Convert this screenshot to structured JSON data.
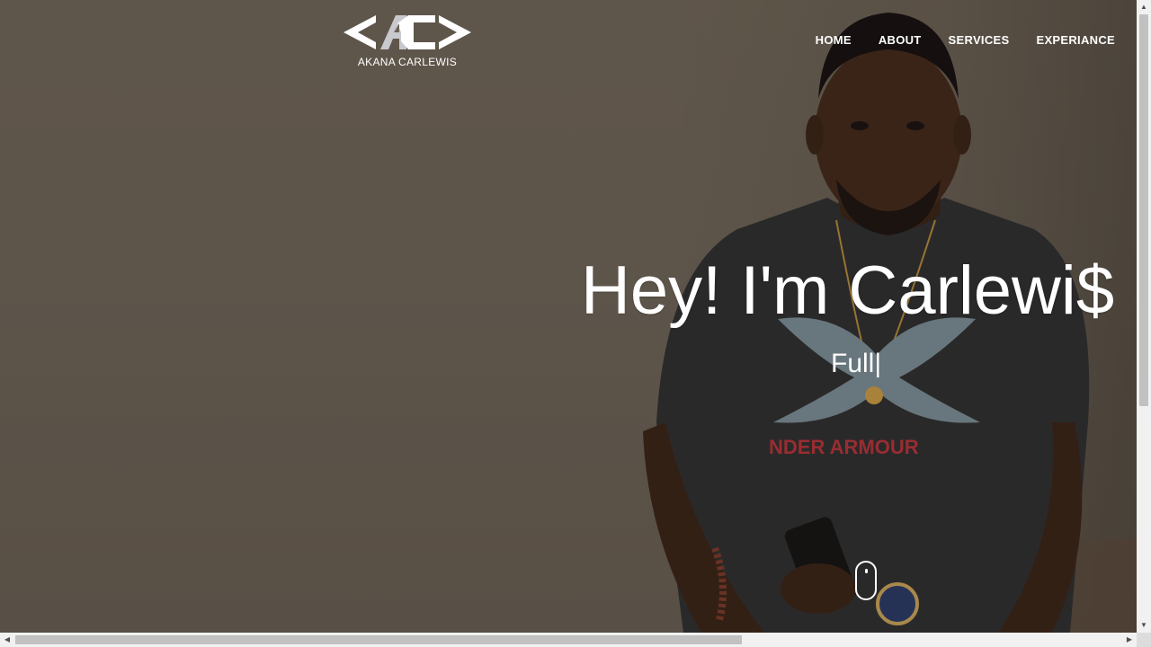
{
  "brand": {
    "name": "AKANA CARLEWIS",
    "logo_icon": "ac-code-brackets-logo"
  },
  "nav": {
    "items": [
      "HOME",
      "ABOUT",
      "SERVICES",
      "EXPERIANCE"
    ]
  },
  "hero": {
    "headline": "Hey! I'm Carlewi$",
    "typed_text": "Full|",
    "photo_shirt_text": "NDER ARMOUR"
  },
  "colors": {
    "text": "#ffffff",
    "background": "#6b6259"
  },
  "icons": {
    "scroll": "scroll-down-mouse-icon",
    "up": "scroll-up-arrow-icon",
    "down": "scroll-down-arrow-icon",
    "left": "scroll-left-arrow-icon",
    "right": "scroll-right-arrow-icon"
  },
  "scroll": {
    "up": "▲",
    "down": "▼",
    "left": "◀",
    "right": "▶"
  }
}
